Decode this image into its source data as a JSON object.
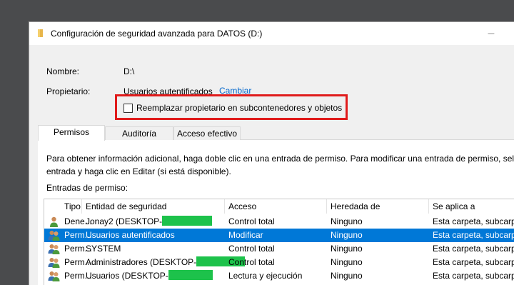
{
  "window": {
    "title": "Configuración de seguridad avanzada para DATOS (D:)",
    "minimize_symbol": "–"
  },
  "fields": {
    "name_label": "Nombre:",
    "name_value": "D:\\",
    "owner_label": "Propietario:",
    "owner_value": "Usuarios autentificados",
    "change_link": "Cambiar",
    "replace_owner_label": "Reemplazar propietario en subcontenedores y objetos",
    "replace_owner_checked": false
  },
  "tabs": [
    {
      "label": "Permisos",
      "active": true
    },
    {
      "label": "Auditoría",
      "active": false
    },
    {
      "label": "Acceso efectivo",
      "active": false
    }
  ],
  "info": {
    "line1": "Para obtener información adicional, haga doble clic en una entrada de permiso. Para modificar una entrada de permiso, selec",
    "line2": "entrada y haga clic en Editar (si está disponible)."
  },
  "entries_label": "Entradas de permiso:",
  "table": {
    "headers": [
      "Tipo",
      "Entidad de seguridad",
      "Acceso",
      "Heredada de",
      "Se aplica a"
    ],
    "rows": [
      {
        "tipo": "Dene...",
        "entidad": "Jonay2 (DESKTOP-",
        "acceso": "Control total",
        "heredada": "Ninguno",
        "aplica": "Esta carpeta, subcarpe",
        "icon": "single-user-icon",
        "selected": false
      },
      {
        "tipo": "Perm...",
        "entidad": "Usuarios autentificados",
        "acceso": "Modificar",
        "heredada": "Ninguno",
        "aplica": "Esta carpeta, subcarpe",
        "icon": "group-users-icon",
        "selected": true
      },
      {
        "tipo": "Perm...",
        "entidad": "SYSTEM",
        "acceso": "Control total",
        "heredada": "Ninguno",
        "aplica": "Esta carpeta, subcarpe",
        "icon": "group-users-icon",
        "selected": false
      },
      {
        "tipo": "Perm...",
        "entidad": "Administradores (DESKTOP-",
        "acceso": "Control total",
        "heredada": "Ninguno",
        "aplica": "Esta carpeta, subcarpe",
        "icon": "group-users-icon",
        "selected": false
      },
      {
        "tipo": "Perm...",
        "entidad": "Usuarios (DESKTOP-",
        "acceso": "Lectura y ejecución",
        "heredada": "Ninguno",
        "aplica": "Esta carpeta, subcarpe",
        "icon": "group-users-icon",
        "selected": false
      }
    ]
  },
  "colors": {
    "accent": "#0078d7",
    "highlight_box": "#e01b1b",
    "redaction": "#1dc24b",
    "link": "#0066cc"
  }
}
